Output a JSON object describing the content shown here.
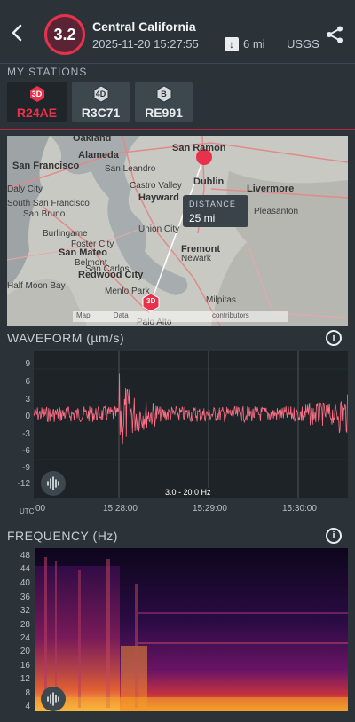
{
  "header": {
    "back_icon": "chevron-left-icon",
    "magnitude": "3.2",
    "title": "Central California",
    "datetime": "2025-11-20 15:27:55",
    "distance_icon": "arrow-down-icon",
    "distance": "6 mi",
    "source": "USGS",
    "share_icon": "share-icon"
  },
  "stations": {
    "label": "MY STATIONS",
    "items": [
      {
        "badge": "3D",
        "code": "R24AE",
        "active": true
      },
      {
        "badge": "4D",
        "code": "R3C71",
        "active": false
      },
      {
        "badge": "B",
        "code": "RE991",
        "active": false
      }
    ]
  },
  "map": {
    "distance_label": "DISTANCE",
    "distance_value": "25 mi",
    "station_marker": "3D",
    "attribution_left": "Map",
    "attribution_mid": "Data",
    "attribution_right": "contributors",
    "places": [
      "Oakland",
      "Alameda",
      "San Ramon",
      "San Francisco",
      "San Leandro",
      "Dublin",
      "Castro Valley",
      "Livermore",
      "Daly City",
      "Hayward",
      "South San Francisco",
      "San Bruno",
      "Union City",
      "Pleasanton",
      "Burlingame",
      "Fremont",
      "Foster City",
      "San Mateo",
      "Newark",
      "Belmont",
      "Redwood City",
      "San Carlos",
      "Half Moon Bay",
      "Menlo Park",
      "Milpitas",
      "Palo Alto"
    ]
  },
  "waveform": {
    "title": "WAVEFORM (µm/s)",
    "info_icon": "info-icon",
    "y_ticks": [
      "9",
      "6",
      "3",
      "0",
      "-3",
      "-6",
      "-9",
      "-12"
    ],
    "x_ticks": [
      "00",
      "15:28:00",
      "15:29:00",
      "15:30:00"
    ],
    "x_unit": "UTC",
    "filter": "3.0 - 20.0 Hz",
    "audio_icon": "soundwave-icon",
    "colors": {
      "trace": "#ff6f86",
      "background": "#1d2327"
    }
  },
  "frequency": {
    "title": "FREQUENCY (Hz)",
    "info_icon": "info-icon",
    "y_ticks": [
      "48",
      "44",
      "40",
      "36",
      "32",
      "28",
      "24",
      "20",
      "16",
      "12",
      "8",
      "4"
    ],
    "audio_icon": "soundwave-icon"
  },
  "colors": {
    "accent": "#e8324d",
    "background": "#2b3339"
  }
}
